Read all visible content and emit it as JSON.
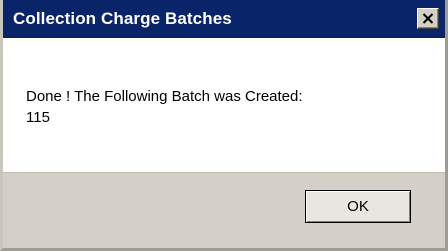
{
  "window": {
    "title": "Collection Charge Batches",
    "close_icon": "close-icon"
  },
  "message": {
    "line1": "Done ! The Following Batch was Created:",
    "line2": "115"
  },
  "buttons": {
    "ok_label": "OK"
  },
  "colors": {
    "titlebar": "#0a246a",
    "title_text": "#ffffff",
    "content_bg": "#ffffff",
    "footer_bg": "#d4d0c8"
  }
}
